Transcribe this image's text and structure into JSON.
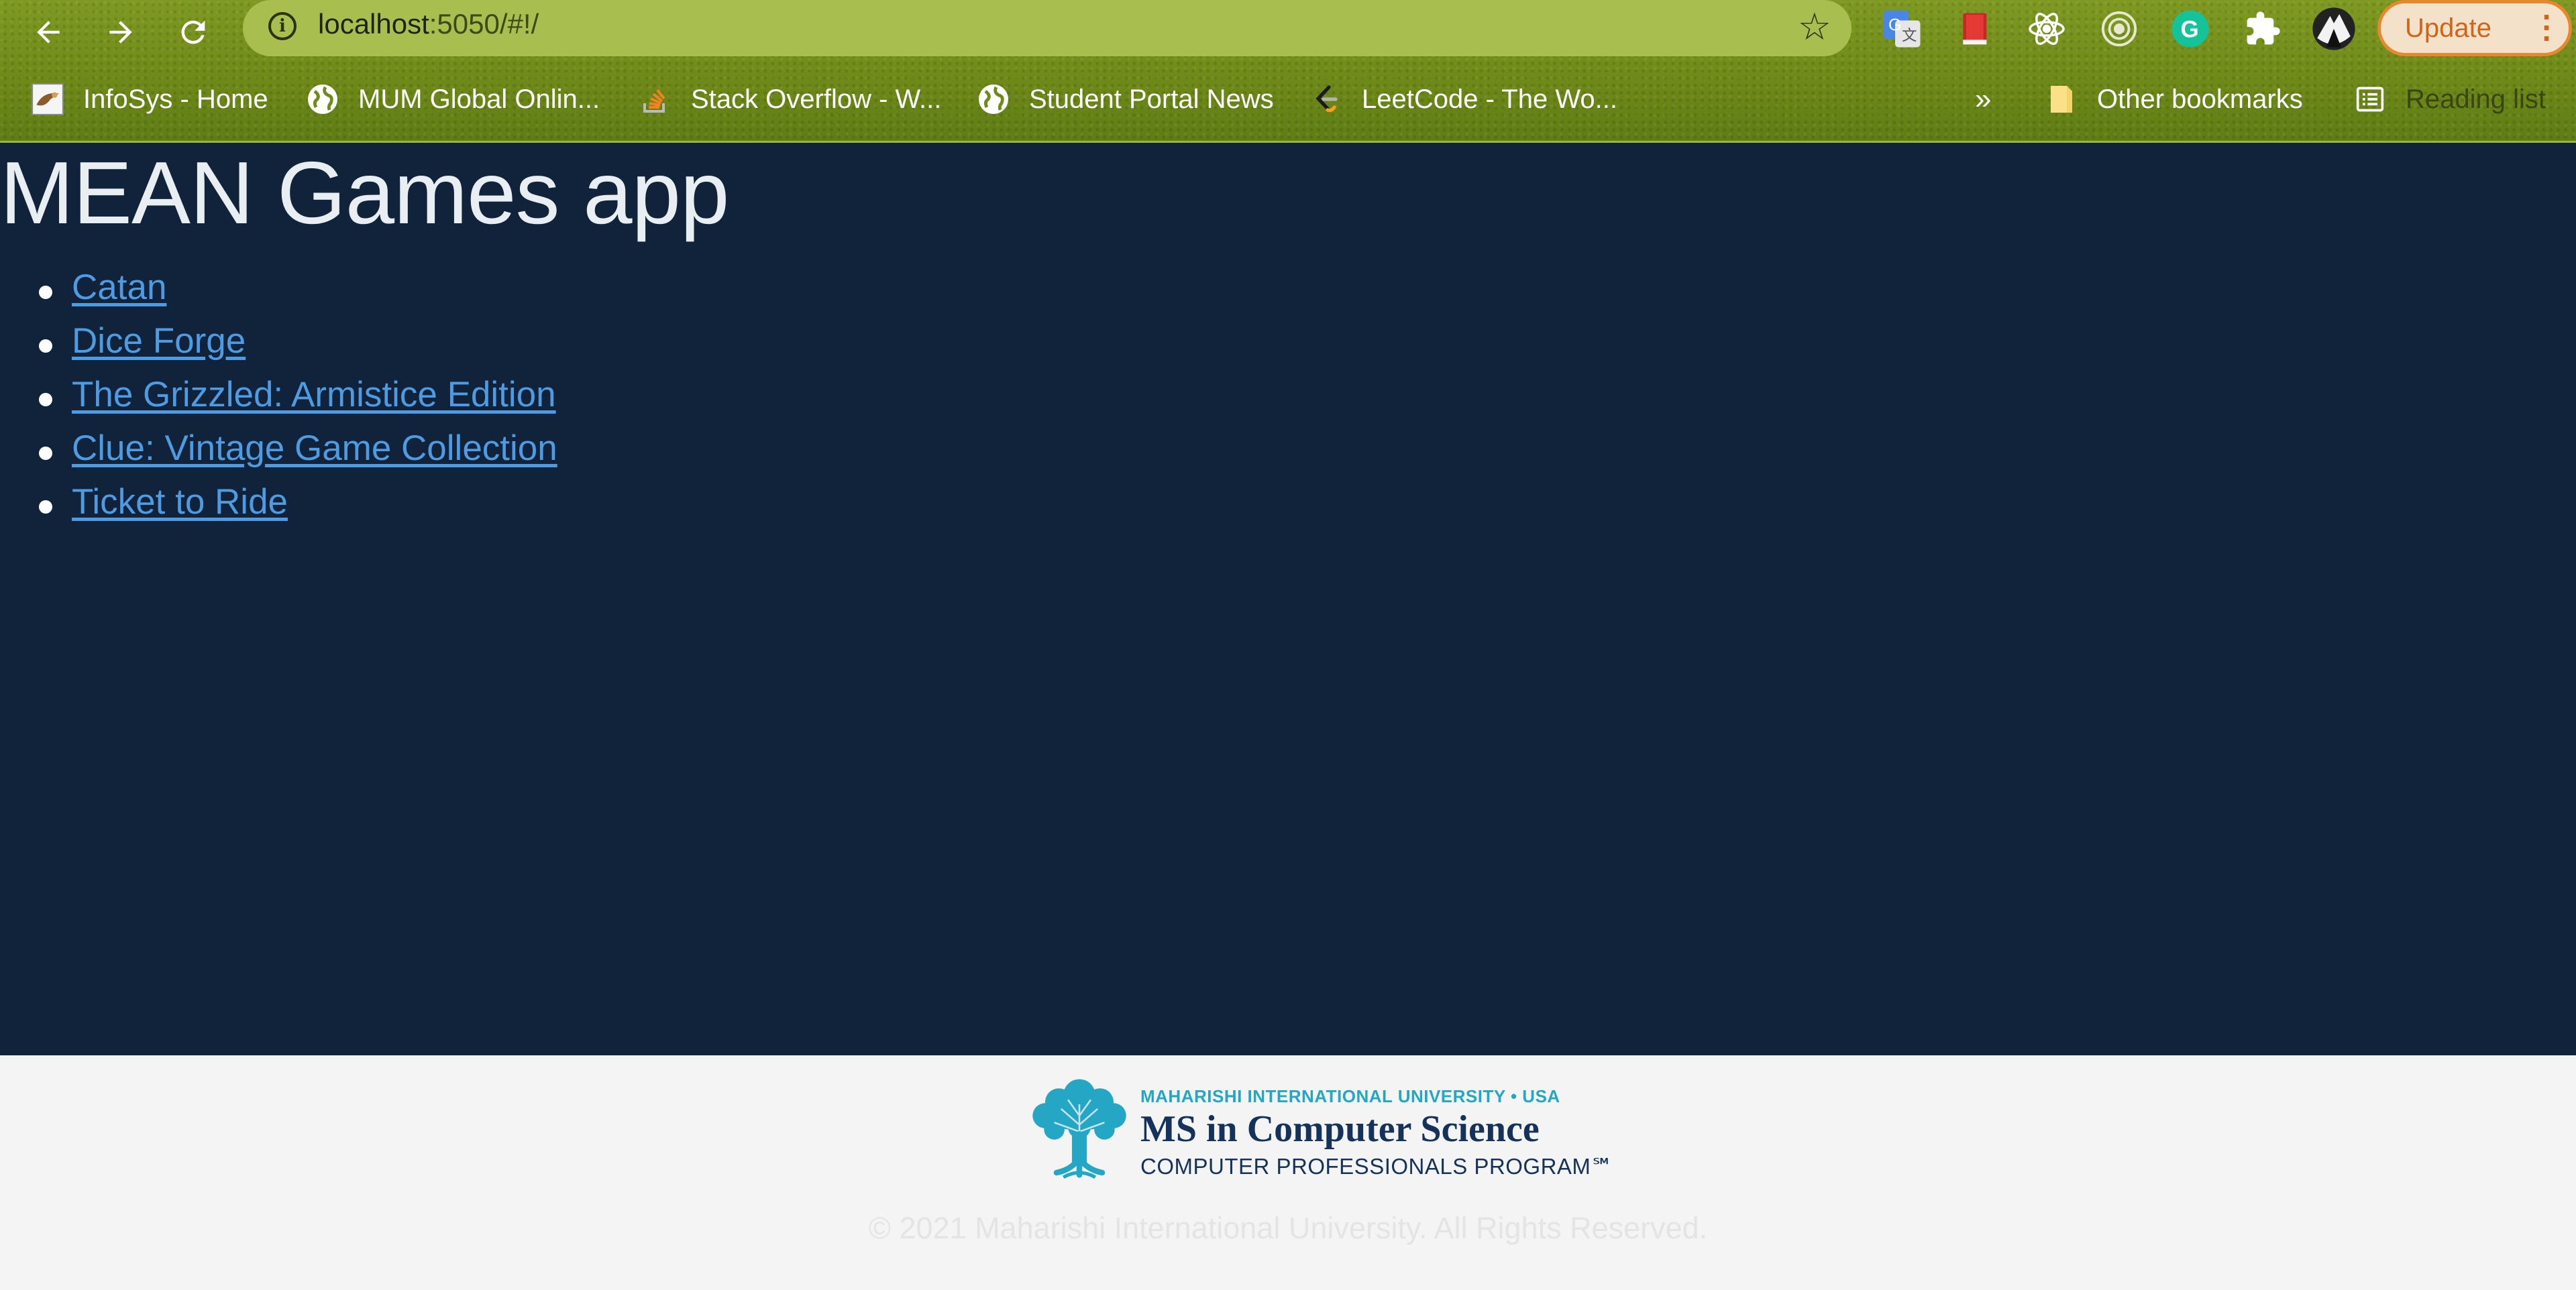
{
  "browser": {
    "url_host": "localhost",
    "url_path": ":5050/#!/",
    "update_label": "Update",
    "bookmarks": [
      {
        "label": "InfoSys - Home",
        "icon": "infosys-icon"
      },
      {
        "label": "MUM Global Onlin...",
        "icon": "globe-icon"
      },
      {
        "label": "Stack Overflow - W...",
        "icon": "stackoverflow-icon"
      },
      {
        "label": "Student Portal News",
        "icon": "globe-icon"
      },
      {
        "label": "LeetCode - The Wo...",
        "icon": "leetcode-icon"
      }
    ],
    "overflow_label": "»",
    "other_bookmarks_label": "Other bookmarks",
    "reading_list_label": "Reading list",
    "accent_color": "#e8872e"
  },
  "page": {
    "title": "MEAN Games app",
    "games": [
      {
        "label": "Catan"
      },
      {
        "label": "Dice Forge"
      },
      {
        "label": "The Grizzled: Armistice Edition"
      },
      {
        "label": "Clue: Vintage Game Collection"
      },
      {
        "label": "Ticket to Ride"
      }
    ],
    "background_color": "#10233a",
    "link_color": "#4d9be2"
  },
  "footer": {
    "logo_line1": "MAHARISHI INTERNATIONAL UNIVERSITY • USA",
    "logo_line2": "MS in Computer Science",
    "logo_line3": "COMPUTER PROFESSIONALS PROGRAM℠",
    "copyright": "© 2021 Maharishi International University. All Rights Reserved."
  }
}
